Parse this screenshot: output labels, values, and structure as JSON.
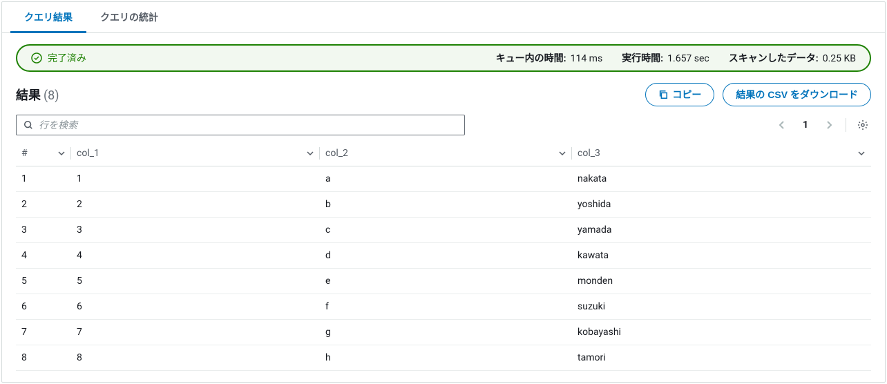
{
  "tabs": [
    {
      "label": "クエリ結果",
      "active": true
    },
    {
      "label": "クエリの統計",
      "active": false
    }
  ],
  "status": {
    "text": "完了済み",
    "stats": [
      {
        "label": "キュー内の時間:",
        "value": "114 ms"
      },
      {
        "label": "実行時間:",
        "value": "1.657 sec"
      },
      {
        "label": "スキャンしたデータ:",
        "value": "0.25 KB"
      }
    ]
  },
  "results": {
    "title": "結果",
    "count": "(8)"
  },
  "actions": {
    "copy": "コピー",
    "download": "結果の CSV をダウンロード"
  },
  "search": {
    "placeholder": "行を検索"
  },
  "pagination": {
    "page": "1"
  },
  "columns": [
    {
      "label": "#"
    },
    {
      "label": "col_1"
    },
    {
      "label": "col_2"
    },
    {
      "label": "col_3"
    }
  ],
  "rows": [
    {
      "n": "1",
      "c1": "1",
      "c2": "a",
      "c3": "nakata"
    },
    {
      "n": "2",
      "c1": "2",
      "c2": "b",
      "c3": "yoshida"
    },
    {
      "n": "3",
      "c1": "3",
      "c2": "c",
      "c3": "yamada"
    },
    {
      "n": "4",
      "c1": "4",
      "c2": "d",
      "c3": "kawata"
    },
    {
      "n": "5",
      "c1": "5",
      "c2": "e",
      "c3": "monden"
    },
    {
      "n": "6",
      "c1": "6",
      "c2": "f",
      "c3": "suzuki"
    },
    {
      "n": "7",
      "c1": "7",
      "c2": "g",
      "c3": "kobayashi"
    },
    {
      "n": "8",
      "c1": "8",
      "c2": "h",
      "c3": "tamori"
    }
  ]
}
